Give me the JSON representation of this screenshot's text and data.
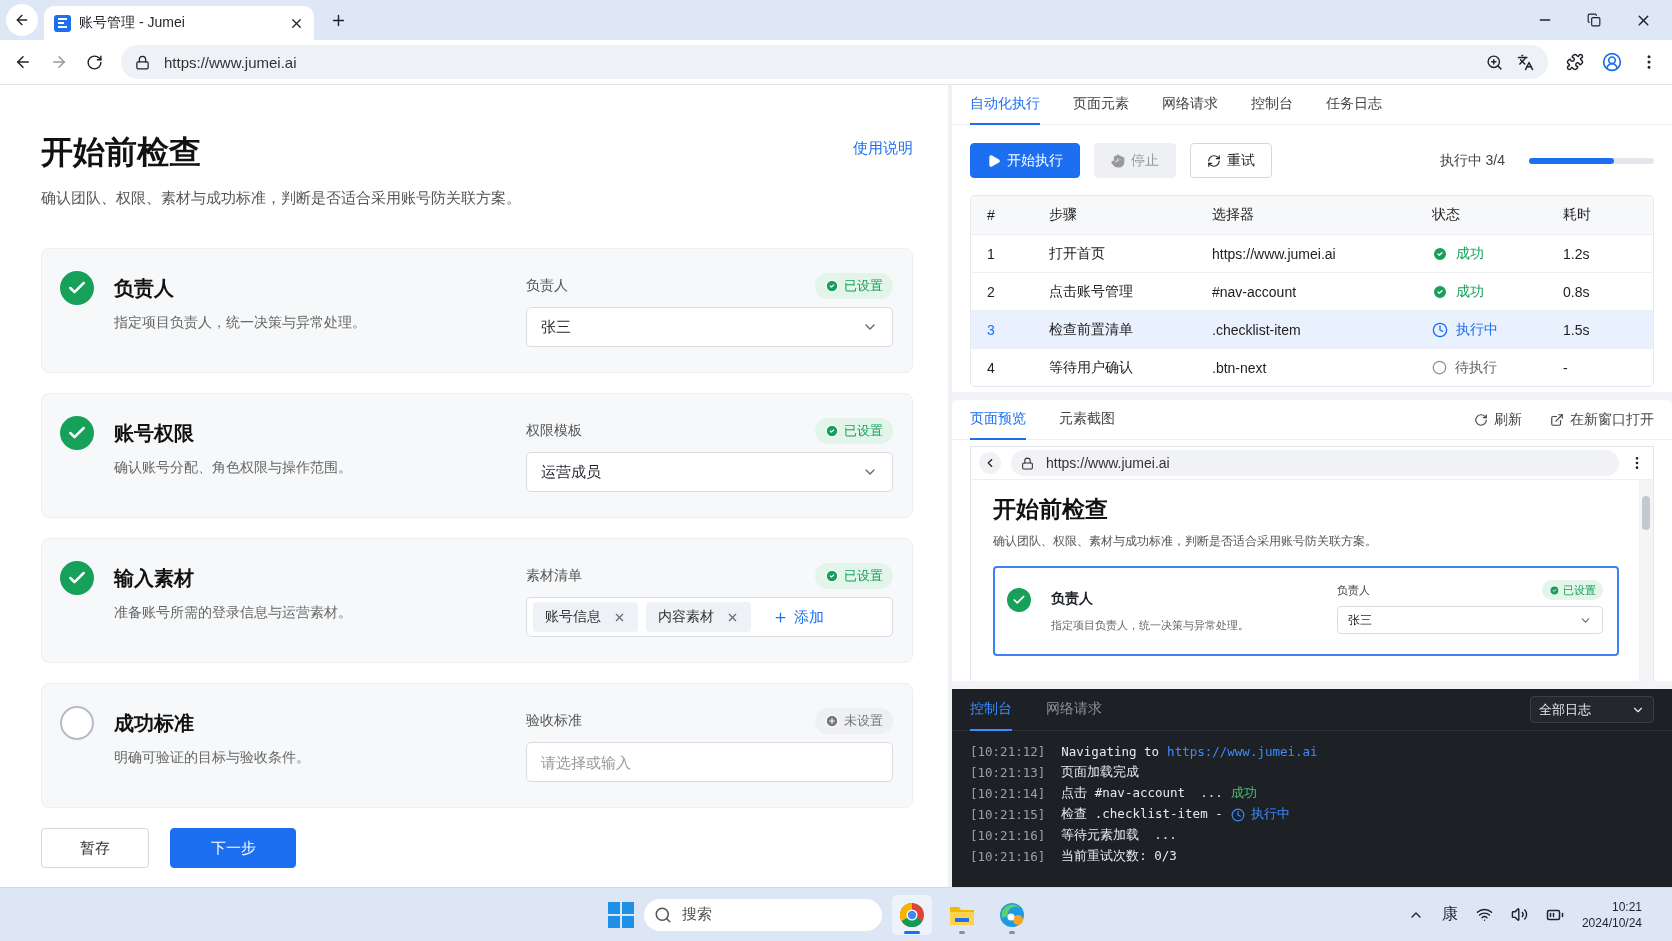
{
  "browser": {
    "tab_title": "账号管理 - Jumei",
    "url": "https://www.jumei.ai"
  },
  "page": {
    "title": "开始前检查",
    "help_link": "使用说明",
    "subtitle": "确认团队、权限、素材与成功标准，判断是否适合采用账号防关联方案。",
    "items": [
      {
        "title": "负责人",
        "desc": "指定项目负责人，统一决策与异常处理。",
        "done": true,
        "field_label": "负责人",
        "status": {
          "text": "已设置",
          "set": true
        },
        "kind": "select",
        "value": "张三"
      },
      {
        "title": "账号权限",
        "desc": "确认账号分配、角色权限与操作范围。",
        "done": true,
        "field_label": "权限模板",
        "status": {
          "text": "已设置",
          "set": true
        },
        "kind": "select",
        "value": "运营成员"
      },
      {
        "title": "输入素材",
        "desc": "准备账号所需的登录信息与运营素材。",
        "done": true,
        "field_label": "素材清单",
        "status": {
          "text": "已设置",
          "set": true
        },
        "kind": "tags",
        "tags": [
          "账号信息",
          "内容素材"
        ],
        "add_label": "添加"
      },
      {
        "title": "成功标准",
        "desc": "明确可验证的目标与验收条件。",
        "done": false,
        "field_label": "验收标准",
        "status": {
          "text": "未设置",
          "set": false
        },
        "kind": "input",
        "placeholder": "请选择或输入"
      }
    ],
    "buttons": [
      {
        "label": "暂存",
        "kind": "secondary"
      },
      {
        "label": "下一步",
        "kind": "primary"
      }
    ]
  },
  "automation": {
    "tabs": [
      {
        "label": "自动化执行",
        "selected": true
      },
      {
        "label": "页面元素",
        "selected": false
      },
      {
        "label": "网络请求",
        "selected": false
      },
      {
        "label": "控制台",
        "selected": false
      },
      {
        "label": "任务日志",
        "selected": false
      }
    ],
    "actions": [
      {
        "label": "开始执行",
        "kind": "run",
        "disabled": false
      },
      {
        "label": "停止",
        "kind": "stop",
        "disabled": true
      },
      {
        "label": "重试",
        "kind": "retry",
        "disabled": false
      }
    ],
    "progress": {
      "label": "执行中 3/4",
      "level": 0.68
    },
    "columns": [
      "#",
      "步骤",
      "选择器",
      "状态",
      "耗时"
    ],
    "rows": [
      {
        "index": "1",
        "step": "打开首页",
        "selector": "https://www.jumei.ai",
        "status": {
          "kind": "success",
          "text": "成功"
        },
        "time": "1.2s",
        "selected": false
      },
      {
        "index": "2",
        "step": "点击账号管理",
        "selector": "#nav-account",
        "status": {
          "kind": "success",
          "text": "成功"
        },
        "time": "0.8s",
        "selected": false
      },
      {
        "index": "3",
        "step": "检查前置清单",
        "selector": ".checklist-item",
        "status": {
          "kind": "running",
          "text": "执行中"
        },
        "time": "1.5s",
        "selected": true
      },
      {
        "index": "4",
        "step": "等待用户确认",
        "selector": ".btn-next",
        "status": {
          "kind": "pending",
          "text": "待执行"
        },
        "time": "-",
        "selected": false
      }
    ]
  },
  "preview": {
    "tabs": [
      {
        "label": "页面预览",
        "selected": true
      },
      {
        "label": "元素截图",
        "selected": false
      }
    ],
    "actions": [
      {
        "label": "刷新",
        "kind": "refresh"
      },
      {
        "label": "在新窗口打开",
        "kind": "open"
      }
    ],
    "url": "https://www.jumei.ai",
    "title": "开始前检查",
    "subtitle": "确认团队、权限、素材与成功标准，判断是否适合采用账号防关联方案。",
    "item": {
      "title": "负责人",
      "desc": "指定项目负责人，统一决策与异常处理。",
      "done": true,
      "field_label": "负责人",
      "status": {
        "text": "已设置",
        "set": true
      },
      "value": "张三"
    }
  },
  "console": {
    "tabs": [
      {
        "label": "控制台",
        "selected": true
      },
      {
        "label": "网络请求",
        "selected": false
      }
    ],
    "filter": "全部日志",
    "lines": [
      {
        "time": "[10:21:12]",
        "segments": [
          {
            "kind": "text",
            "text": "Navigating to"
          },
          {
            "kind": "link",
            "text": "https://www.jumei.ai"
          }
        ]
      },
      {
        "time": "[10:21:13]",
        "segments": [
          {
            "kind": "text",
            "text": "页面加载完成"
          }
        ]
      },
      {
        "time": "[10:21:14]",
        "segments": [
          {
            "kind": "text",
            "text": "点击 #nav-account  ..."
          },
          {
            "kind": "success",
            "text": "成功"
          }
        ]
      },
      {
        "time": "[10:21:15]",
        "segments": [
          {
            "kind": "text",
            "text": "检查 .checklist-item -"
          },
          {
            "kind": "running",
            "text": "执行中"
          }
        ]
      },
      {
        "time": "[10:21:16]",
        "segments": [
          {
            "kind": "text",
            "text": "等待元素加载  ..."
          }
        ]
      },
      {
        "time": "[10:21:16]",
        "segments": [
          {
            "kind": "text",
            "text": "当前重试次数: 0/3"
          }
        ]
      }
    ]
  },
  "taskbar": {
    "search_placeholder": "搜索",
    "apps": [
      {
        "kind": "chrome",
        "active": true
      },
      {
        "kind": "files",
        "active": false
      },
      {
        "kind": "edge",
        "active": false
      }
    ],
    "ime": "康",
    "time": "10:21",
    "date": "2024/10/24"
  }
}
